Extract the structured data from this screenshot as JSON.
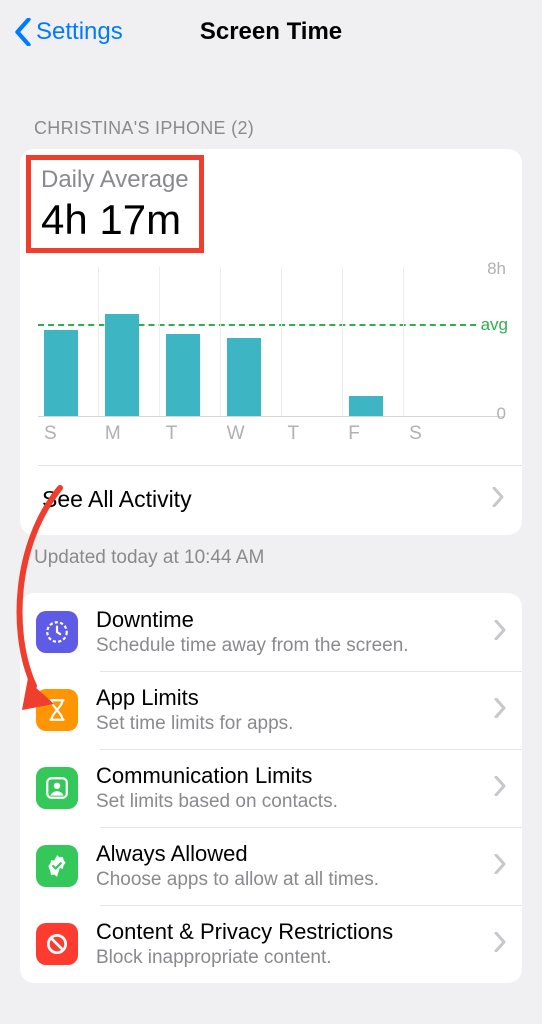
{
  "header": {
    "back_label": "Settings",
    "title": "Screen Time"
  },
  "section_label": "CHRISTINA'S IPHONE (2)",
  "daily": {
    "label": "Daily Average",
    "value": "4h 17m"
  },
  "chart_data": {
    "type": "bar",
    "categories": [
      "S",
      "M",
      "T",
      "W",
      "T",
      "F",
      "S"
    ],
    "values": [
      4.6,
      5.5,
      4.4,
      4.2,
      0,
      1.1,
      0
    ],
    "avg": 4.28,
    "ylim": [
      0,
      8
    ],
    "ytick_top_label": "8h",
    "ytick_bottom_label": "0",
    "avg_label": "avg",
    "title": "",
    "xlabel": "",
    "ylabel": ""
  },
  "see_all_label": "See All Activity",
  "updated_text": "Updated today at 10:44 AM",
  "items": [
    {
      "title": "Downtime",
      "subtitle": "Schedule time away from the screen.",
      "icon": "downtime-icon",
      "color": "#5e5ce6"
    },
    {
      "title": "App Limits",
      "subtitle": "Set time limits for apps.",
      "icon": "hourglass-icon",
      "color": "#ff9500"
    },
    {
      "title": "Communication Limits",
      "subtitle": "Set limits based on contacts.",
      "icon": "contact-icon",
      "color": "#34c759"
    },
    {
      "title": "Always Allowed",
      "subtitle": "Choose apps to allow at all times.",
      "icon": "checkmark-badge-icon",
      "color": "#34c759"
    },
    {
      "title": "Content & Privacy Restrictions",
      "subtitle": "Block inappropriate content.",
      "icon": "nosign-icon",
      "color": "#ff3b30"
    }
  ]
}
